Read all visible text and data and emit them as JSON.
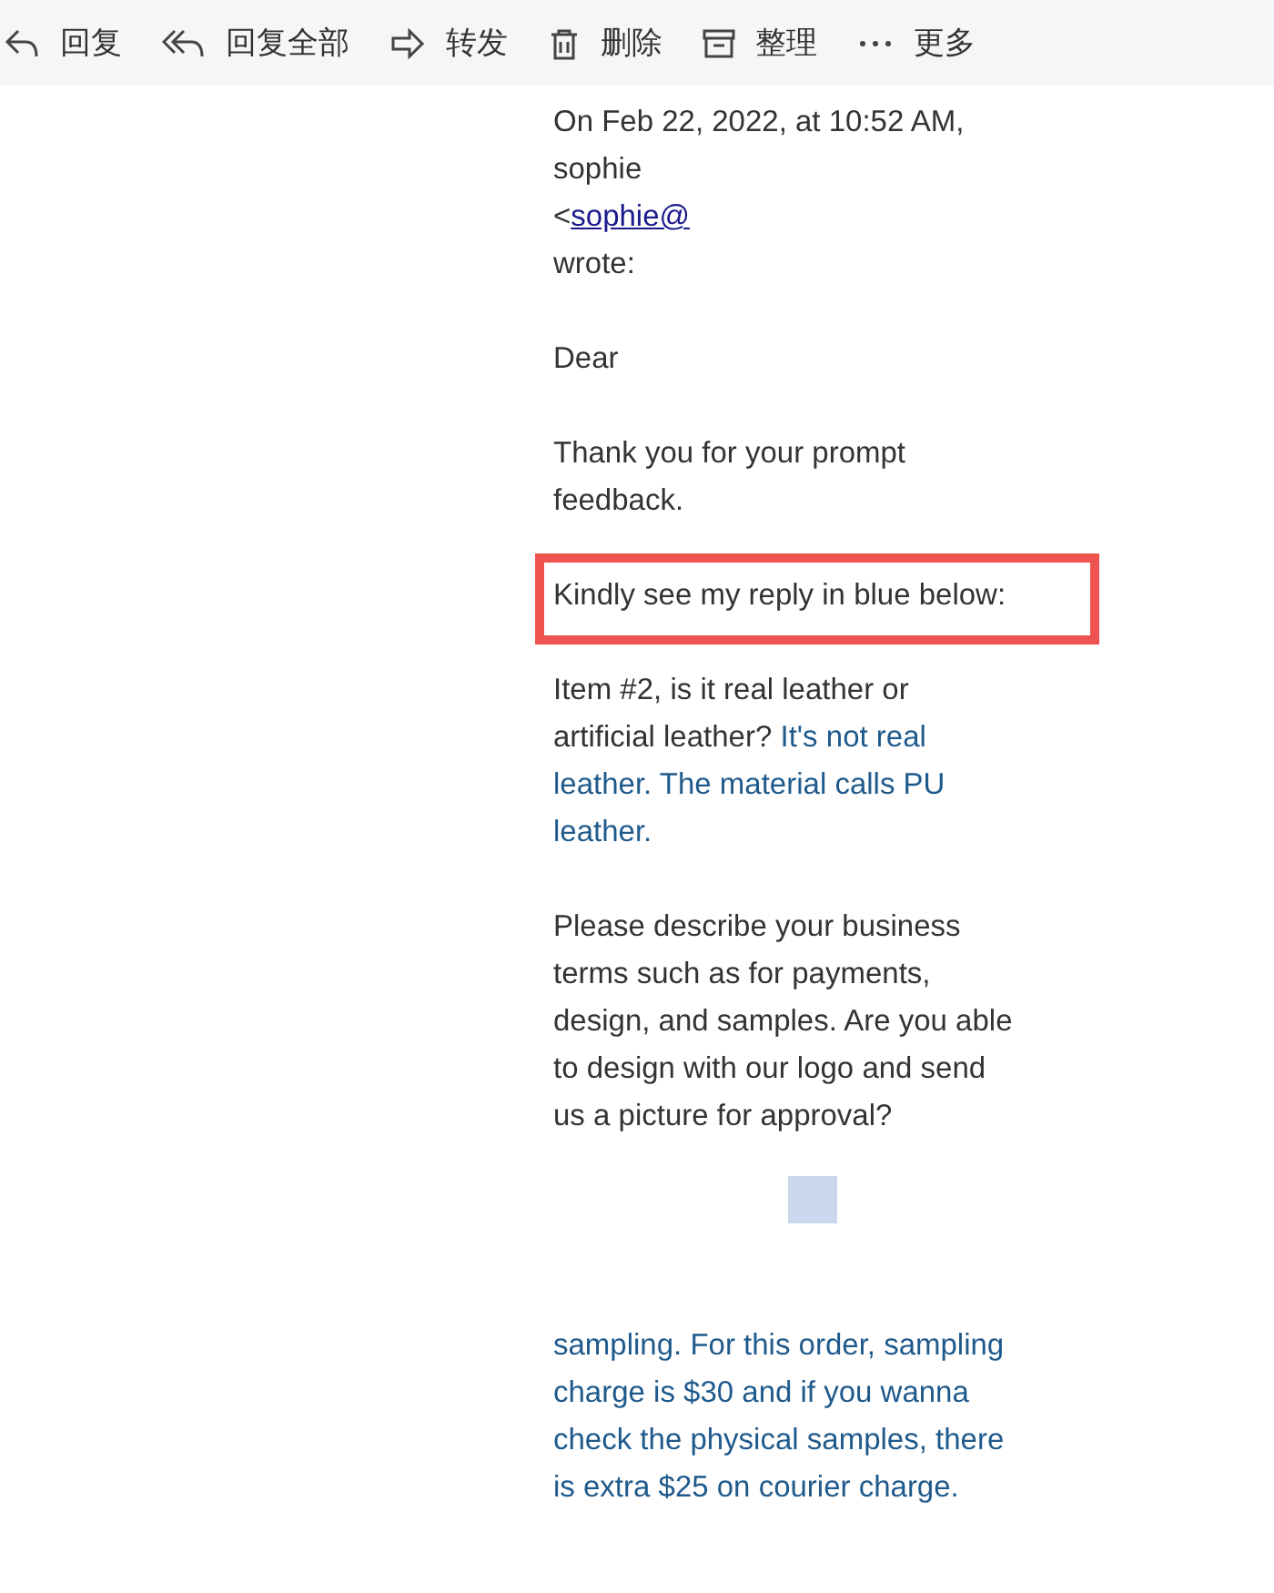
{
  "toolbar": [
    {
      "kind": "reply",
      "label": "回复"
    },
    {
      "kind": "reply-all",
      "label": "回复全部"
    },
    {
      "kind": "forward",
      "label": "转发"
    },
    {
      "kind": "delete",
      "label": "删除"
    },
    {
      "kind": "archive",
      "label": "整理"
    },
    {
      "kind": "more",
      "label": "更多"
    }
  ],
  "header": {
    "date_line": "On Feb 22, 2022, at 10:52 AM,",
    "sender": "sophie",
    "bracket": "<",
    "email": "sophie@",
    "wrote": "wrote:"
  },
  "paragraphs": [
    {
      "highlighted": false,
      "segments": [
        {
          "kind": "plain",
          "text": "Dear"
        }
      ]
    },
    {
      "highlighted": false,
      "segments": [
        {
          "kind": "plain",
          "text": "Thank you for your prompt feedback."
        }
      ]
    },
    {
      "highlighted": true,
      "segments": [
        {
          "kind": "plain",
          "text": "Kindly see my reply in blue below:"
        }
      ]
    },
    {
      "highlighted": false,
      "segments": [
        {
          "kind": "plain",
          "text": "Item #2, is it real leather or artificial leather?"
        },
        {
          "kind": "reply",
          "text": "It's not real leather. The material calls PU leather."
        }
      ]
    },
    {
      "highlighted": false,
      "segments": [
        {
          "kind": "plain",
          "text": "Please describe your business terms such as for payments, design, and samples. Are you able to design with our logo and send us a picture for approval?"
        }
      ]
    },
    {
      "highlighted": false,
      "segments": [
        {
          "kind": "reply",
          "text": "sampling. For this order, sampling charge is $30 and if you wanna check the physical samples, there is extra $25 on courier charge."
        }
      ]
    }
  ]
}
